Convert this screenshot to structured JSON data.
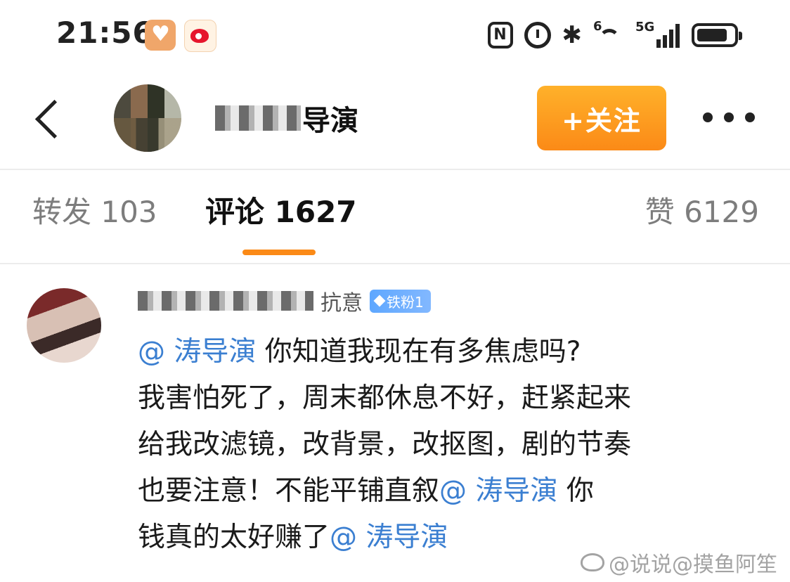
{
  "status_bar": {
    "time": "21:56",
    "icons": [
      "heart-app-icon",
      "weibo-app-icon",
      "nfc-icon",
      "alarm-icon",
      "bluetooth-icon",
      "wifi-icon",
      "signal-5g-icon",
      "battery-icon"
    ],
    "nfc_label": "N",
    "bt_glyph": "✱",
    "network_label": "5G"
  },
  "header": {
    "back_icon": "chevron-left-icon",
    "user_name": "导演",
    "follow_label": "+关注",
    "more_icon": "more-horizontal-icon"
  },
  "tabs": [
    {
      "label": "转发 103",
      "active": false
    },
    {
      "label": "评论 1627",
      "active": true
    },
    {
      "label": "赞 6129",
      "active": false
    }
  ],
  "accent_color": "#fb8a17",
  "link_color": "#3b7fd1",
  "comment": {
    "name_visible": "抗意",
    "badge": "铁粉1",
    "lines": [
      {
        "mention": "@  涛导演",
        "text": " 你知道我现在有多焦虑吗?"
      },
      {
        "mention": "",
        "text": "我害怕死了，周末都休息不好，赶紧起来"
      },
      {
        "mention": "",
        "text": "给我改滤镜，改背景，改抠图，剧的节奏"
      },
      {
        "mention_after": "@ 涛导演",
        "text": "也要注意！不能平铺直叙",
        "tail": " 你"
      },
      {
        "mention_after": "@ 涛导演",
        "text": "钱真的太好赚了"
      }
    ]
  },
  "watermark": "@说说@摸鱼阿笙"
}
